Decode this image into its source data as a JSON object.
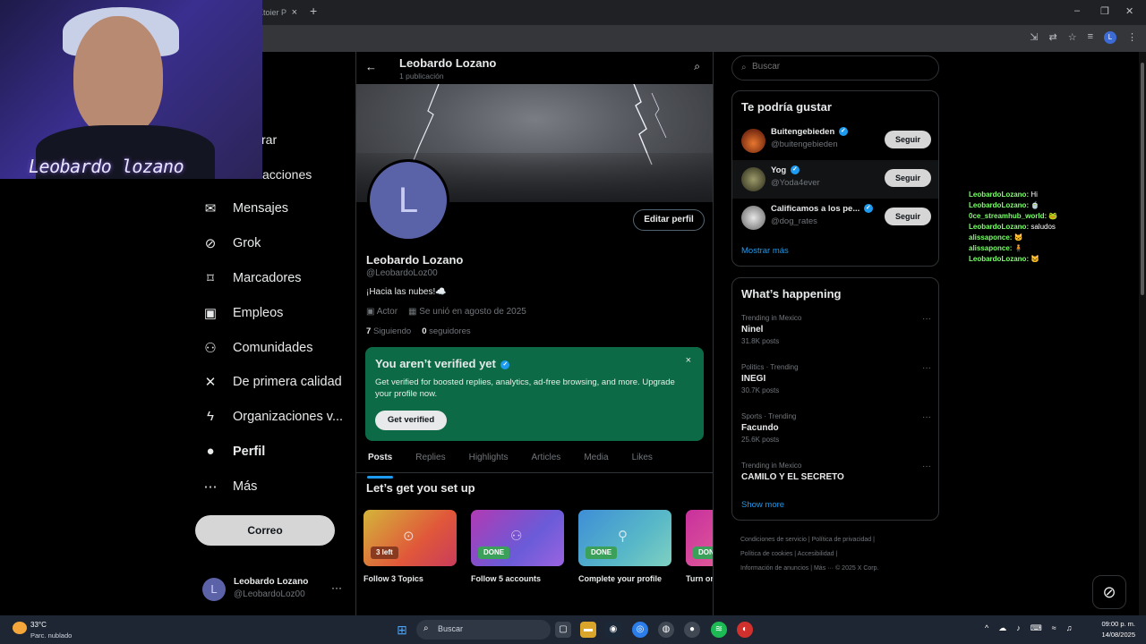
{
  "browser": {
    "tab_title": "Xtoier P",
    "tab_close": "×",
    "new_tab": "+",
    "window_controls": [
      "–",
      "❐",
      "✕"
    ],
    "profile_initial": "L"
  },
  "webcam": {
    "overlay_name": "Leobardo lozano"
  },
  "nav": {
    "partial_items": [
      "rar",
      "cacciones"
    ],
    "items": [
      {
        "label": "Mensajes",
        "icon": "mail-icon",
        "glyph": "✉"
      },
      {
        "label": "Grok",
        "icon": "grok-icon",
        "glyph": "⊘"
      },
      {
        "label": "Marcadores",
        "icon": "bookmark-icon",
        "glyph": "⌑"
      },
      {
        "label": "Empleos",
        "icon": "briefcase-icon",
        "glyph": "▣"
      },
      {
        "label": "Comunidades",
        "icon": "people-icon",
        "glyph": "⚇"
      },
      {
        "label": "De primera calidad",
        "icon": "x-logo-icon",
        "glyph": "✕"
      },
      {
        "label": "Organizaciones v...",
        "icon": "lightning-icon",
        "glyph": "ϟ"
      },
      {
        "label": "Perfil",
        "icon": "person-icon",
        "glyph": "●"
      },
      {
        "label": "Más",
        "icon": "more-circle-icon",
        "glyph": "⋯"
      }
    ],
    "post_button": "Correo",
    "account": {
      "initial": "L",
      "name": "Leobardo Lozano",
      "handle": "@LeobardoLoz00",
      "more": "···"
    }
  },
  "header": {
    "back": "←",
    "title": "Leobardo Lozano",
    "subtitle": "1 publicación",
    "search": "⌕"
  },
  "profile": {
    "avatar_initial": "L",
    "edit_button": "Editar perfil",
    "name": "Leobardo Lozano",
    "handle": "@LeobardoLoz00",
    "bio": "¡Hacia las nubes!☁️",
    "category": "Actor",
    "joined": "Se unió en agosto de 2025",
    "following_count": "7",
    "following_label": "Siguiendo",
    "followers_count": "0",
    "followers_label": "seguidores"
  },
  "verify": {
    "title": "You aren’t verified yet",
    "description": "Get verified for boosted replies, analytics, ad-free browsing, and more. Upgrade your profile now.",
    "button": "Get verified",
    "close": "×"
  },
  "tabs": [
    "Posts",
    "Replies",
    "Highlights",
    "Articles",
    "Media",
    "Likes"
  ],
  "setup": {
    "title": "Let’s get you set up",
    "cards": [
      {
        "label": "Follow 3 Topics",
        "badge": "3 left"
      },
      {
        "label": "Follow 5 accounts",
        "badge": "DONE"
      },
      {
        "label": "Complete your profile",
        "badge": "DONE"
      },
      {
        "label": "Turn on",
        "badge": "DON"
      }
    ]
  },
  "search": {
    "placeholder": "Buscar"
  },
  "suggestions": {
    "title": "Te podría gustar",
    "items": [
      {
        "name": "Buitengebieden",
        "handle": "@buitengebieden",
        "button": "Seguir"
      },
      {
        "name": "Yog",
        "handle": "@Yoda4ever",
        "button": "Seguir"
      },
      {
        "name": "Calificamos a los pe...",
        "handle": "@dog_rates",
        "button": "Seguir"
      }
    ],
    "more": "Mostrar más"
  },
  "happening": {
    "title": "What’s happening",
    "trends": [
      {
        "context": "Trending in Mexico",
        "topic": "Ninel",
        "count": "31.8K posts"
      },
      {
        "context": "Politics · Trending",
        "topic": "INEGI",
        "count": "30.7K posts"
      },
      {
        "context": "Sports · Trending",
        "topic": "Facundo",
        "count": "25.6K posts"
      },
      {
        "context": "Trending in Mexico",
        "topic": "CAMILO Y EL SECRETO",
        "count": ""
      }
    ],
    "more": "Show more"
  },
  "footer": {
    "line1": "Condiciones de servicio  |  Política de privacidad  |",
    "line2": "Política de cookies  |  Accesibilidad  |",
    "line3": "Información de anuncios  |  Más ···  © 2025 X Corp."
  },
  "chat": [
    {
      "user": "LeobardoLozano:",
      "msg": "Hi"
    },
    {
      "user": "LeobardoLozano:",
      "msg": "🍵"
    },
    {
      "user": "0ce_streamhub_world:",
      "msg": "🐸"
    },
    {
      "user": "LeobardoLozano:",
      "msg": "saludos"
    },
    {
      "user": "alissaponce:",
      "msg": "🐱"
    },
    {
      "user": "alissaponce:",
      "msg": "🧍"
    },
    {
      "user": "LeobardoLozano:",
      "msg": "🐱"
    }
  ],
  "taskbar": {
    "temperature": "33°C",
    "weather": "Parc. nublado",
    "search": "Buscar",
    "time": "09:00 p. m.",
    "date": "14/08/2025"
  }
}
